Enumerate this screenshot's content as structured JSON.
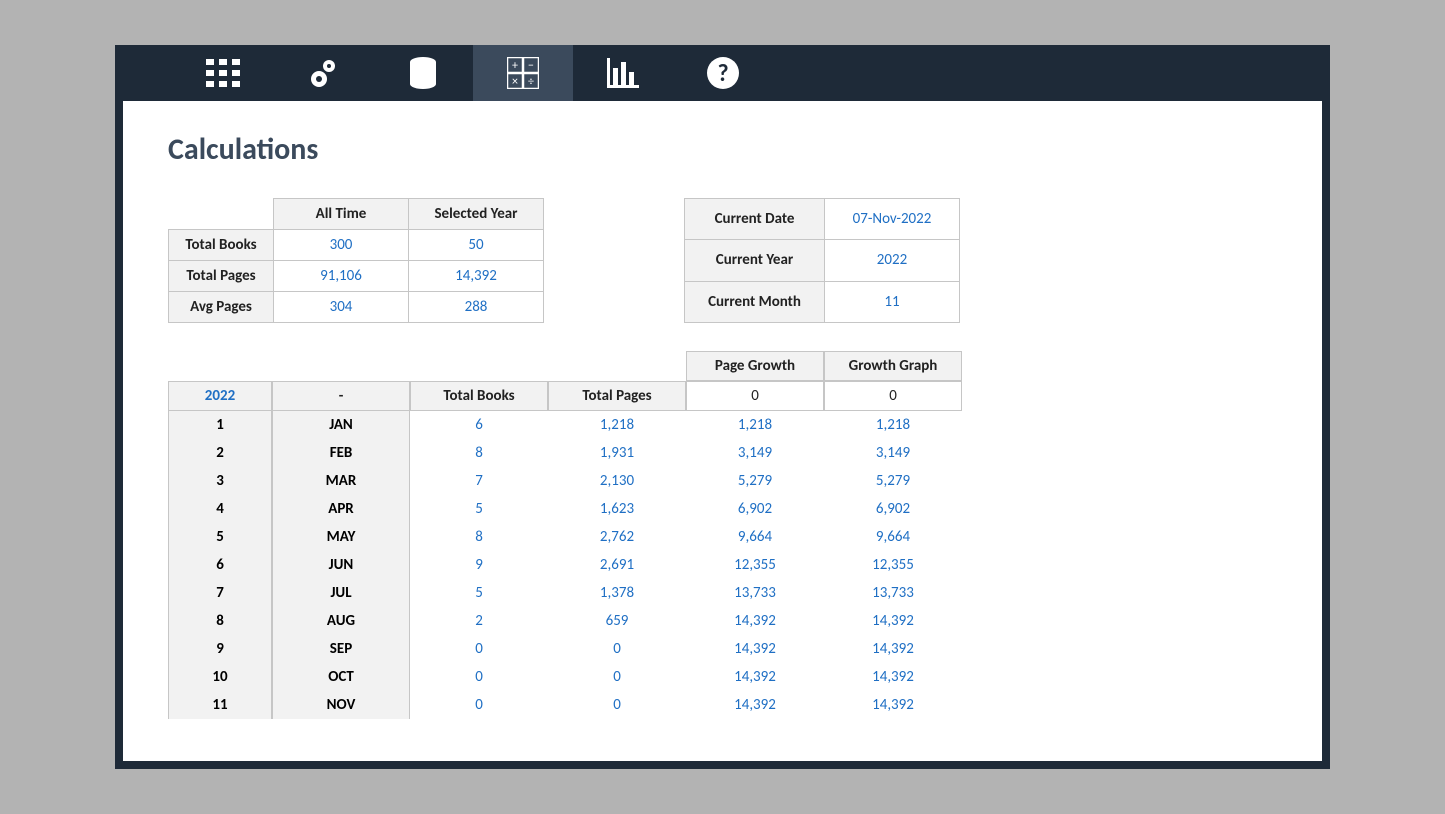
{
  "page_title": "Calculations",
  "toolbar": {
    "items": [
      "grid",
      "settings",
      "database",
      "calculator",
      "chart",
      "help"
    ],
    "active": "calculator"
  },
  "summary": {
    "col_headers": [
      "All Time",
      "Selected Year"
    ],
    "rows": [
      {
        "label": "Total Books",
        "all": "300",
        "sel": "50"
      },
      {
        "label": "Total Pages",
        "all": "91,106",
        "sel": "14,392"
      },
      {
        "label": "Avg Pages",
        "all": "304",
        "sel": "288"
      }
    ]
  },
  "date_info": {
    "rows": [
      {
        "label": "Current Date",
        "value": "07-Nov-2022"
      },
      {
        "label": "Current Year",
        "value": "2022"
      },
      {
        "label": "Current Month",
        "value": "11"
      }
    ]
  },
  "months": {
    "header_top": {
      "page_growth": "Page Growth",
      "growth_graph": "Growth Graph"
    },
    "header": {
      "year": "2022",
      "dash": "-",
      "total_books": "Total Books",
      "total_pages": "Total Pages",
      "pg0": "0",
      "gg0": "0"
    },
    "rows": [
      {
        "n": "1",
        "m": "JAN",
        "tb": "6",
        "tp": "1,218",
        "pg": "1,218",
        "gg": "1,218"
      },
      {
        "n": "2",
        "m": "FEB",
        "tb": "8",
        "tp": "1,931",
        "pg": "3,149",
        "gg": "3,149"
      },
      {
        "n": "3",
        "m": "MAR",
        "tb": "7",
        "tp": "2,130",
        "pg": "5,279",
        "gg": "5,279"
      },
      {
        "n": "4",
        "m": "APR",
        "tb": "5",
        "tp": "1,623",
        "pg": "6,902",
        "gg": "6,902"
      },
      {
        "n": "5",
        "m": "MAY",
        "tb": "8",
        "tp": "2,762",
        "pg": "9,664",
        "gg": "9,664"
      },
      {
        "n": "6",
        "m": "JUN",
        "tb": "9",
        "tp": "2,691",
        "pg": "12,355",
        "gg": "12,355"
      },
      {
        "n": "7",
        "m": "JUL",
        "tb": "5",
        "tp": "1,378",
        "pg": "13,733",
        "gg": "13,733"
      },
      {
        "n": "8",
        "m": "AUG",
        "tb": "2",
        "tp": "659",
        "pg": "14,392",
        "gg": "14,392"
      },
      {
        "n": "9",
        "m": "SEP",
        "tb": "0",
        "tp": "0",
        "pg": "14,392",
        "gg": "14,392"
      },
      {
        "n": "10",
        "m": "OCT",
        "tb": "0",
        "tp": "0",
        "pg": "14,392",
        "gg": "14,392"
      },
      {
        "n": "11",
        "m": "NOV",
        "tb": "0",
        "tp": "0",
        "pg": "14,392",
        "gg": "14,392"
      }
    ]
  }
}
